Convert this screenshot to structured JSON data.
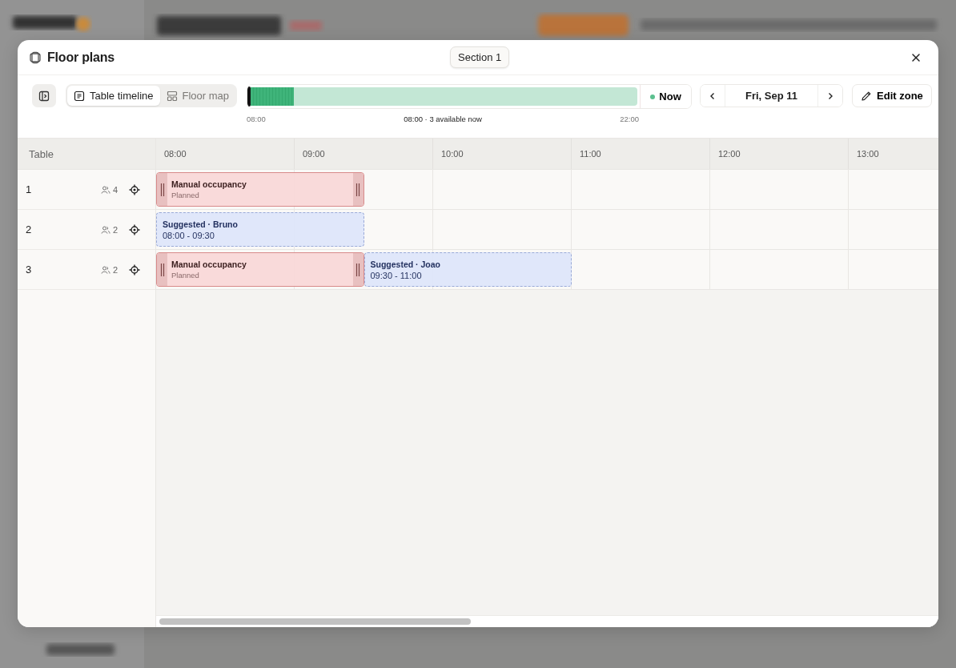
{
  "dialog": {
    "title": "Floor plans",
    "section": "Section 1"
  },
  "toolbar": {
    "views": [
      {
        "label": "Table timeline",
        "selected": true
      },
      {
        "label": "Floor map",
        "selected": false
      }
    ],
    "availability": {
      "level": 0.11,
      "start": "08:00",
      "status": "08:00 · 3 available now",
      "end": "22:00"
    },
    "now_button": "Now",
    "date": "Fri, Sep 11",
    "edit_button": "Edit zone"
  },
  "timeline": {
    "table_header": "Table",
    "hours": [
      "08:00",
      "09:00",
      "10:00",
      "11:00",
      "12:00",
      "13:00"
    ],
    "rows": [
      {
        "table": "1",
        "seats": "4",
        "bookings": [
          {
            "kind": "manual",
            "title": "Manual occupancy",
            "subtitle": "Planned"
          }
        ]
      },
      {
        "table": "2",
        "seats": "2",
        "bookings": [
          {
            "kind": "suggested",
            "title": "Suggested · Bruno",
            "subtitle": "08:00 - 09:30"
          }
        ]
      },
      {
        "table": "3",
        "seats": "2",
        "bookings": [
          {
            "kind": "manual",
            "title": "Manual occupancy",
            "subtitle": "Planned"
          },
          {
            "kind": "suggested",
            "title": "Suggested · Joao",
            "subtitle": "09:30 - 11:00"
          }
        ]
      }
    ]
  }
}
